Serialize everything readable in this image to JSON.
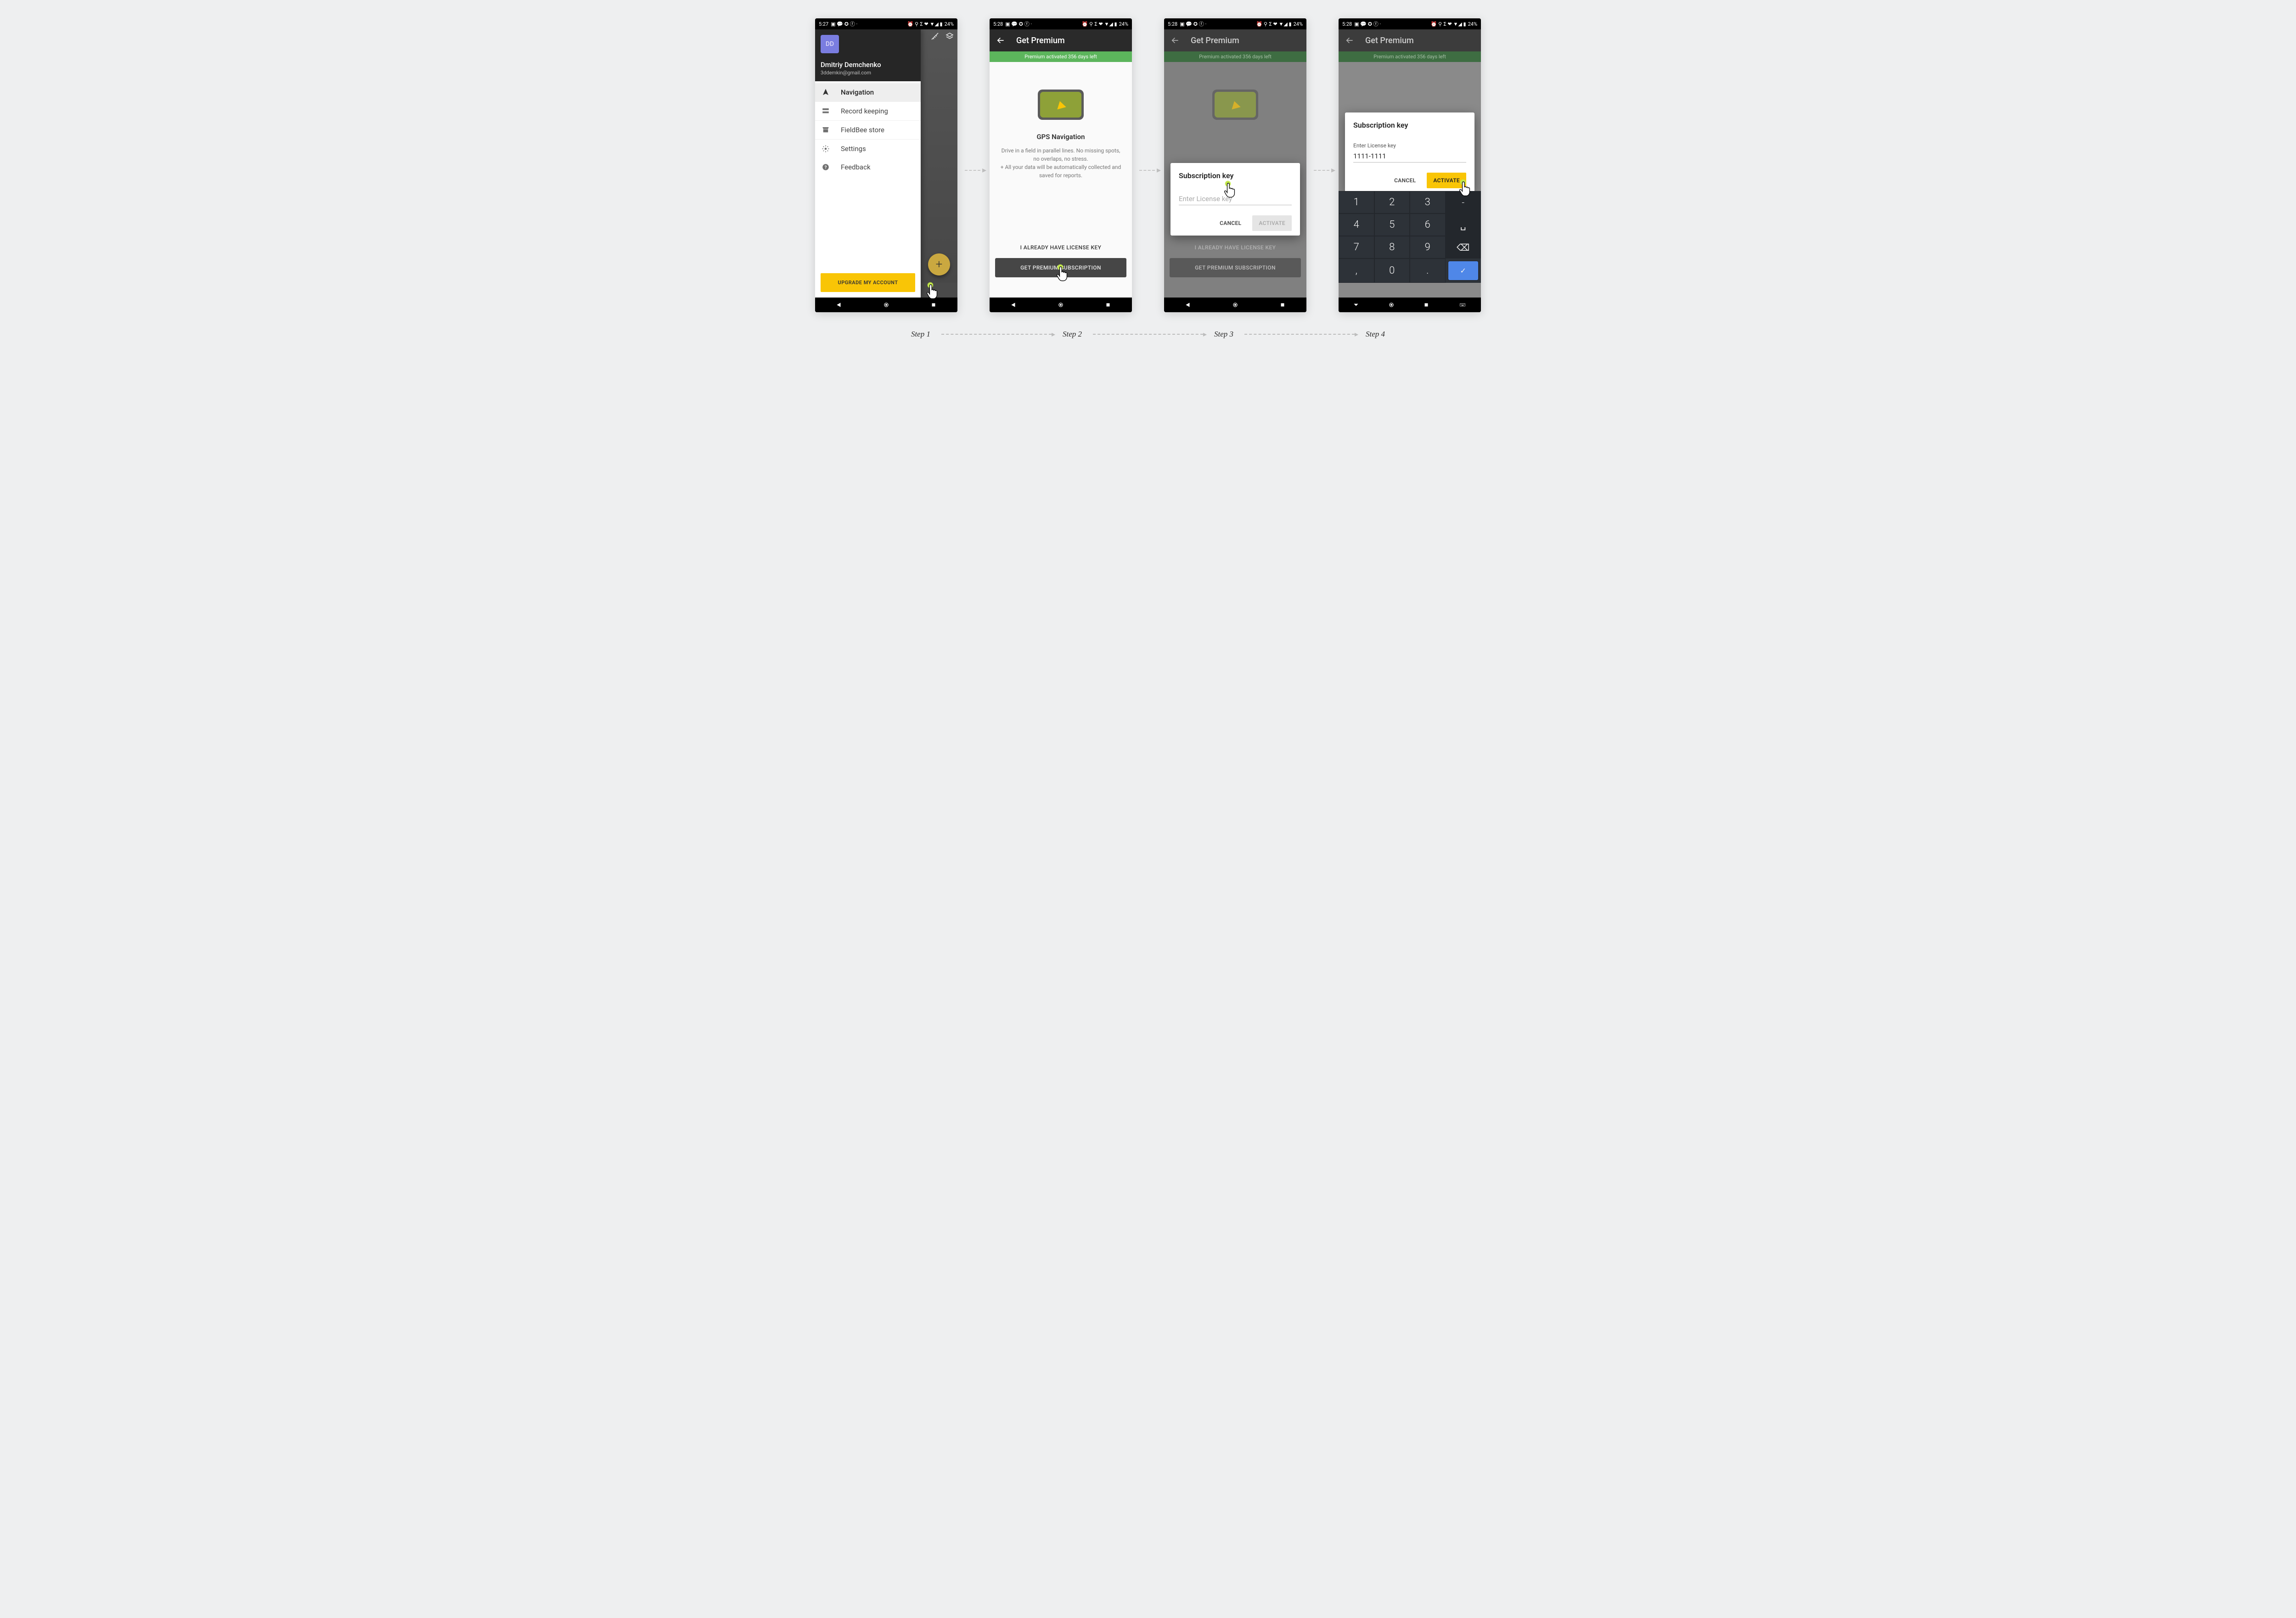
{
  "status": {
    "time1": "5:27",
    "time2": "5:28",
    "battery": "24%"
  },
  "drawer": {
    "avatar_initials": "DD",
    "name": "Dmitriy Demchenko",
    "email": "3ddemkin@gmail.com",
    "items": [
      {
        "label": "Navigation"
      },
      {
        "label": "Record keeping"
      },
      {
        "label": "FieldBee store"
      },
      {
        "label": "Settings"
      },
      {
        "label": "Feedback"
      }
    ],
    "upgrade_label": "UPGRADE MY ACCOUNT"
  },
  "appbar": {
    "title": "Get Premium"
  },
  "banner": {
    "text": "Premium activated 356 days left"
  },
  "premium": {
    "title": "GPS  Navigation",
    "desc1": "Drive in a field in parallel lines. No missing spots, no overlaps, no stress.",
    "desc2": "+ All your data will be automatically collected and saved for reports.",
    "license_link": "I ALREADY  HAVE LICENSE KEY",
    "subscribe_btn": "GET PREMIUM SUBSCRIPTION"
  },
  "dialog": {
    "title": "Subscription key",
    "label": "Enter License key",
    "placeholder": "Enter License key",
    "value": "1111-1111",
    "cancel": "CANCEL",
    "activate": "ACTIVATE"
  },
  "keypad": {
    "keys": [
      "1",
      "2",
      "3",
      "-",
      "4",
      "5",
      "6",
      "⌴",
      "7",
      "8",
      "9",
      "⌫",
      ",",
      "0",
      ".",
      "✓"
    ]
  },
  "steps": {
    "s1": "Step 1",
    "s2": "Step 2",
    "s3": "Step 3",
    "s4": "Step 4"
  }
}
